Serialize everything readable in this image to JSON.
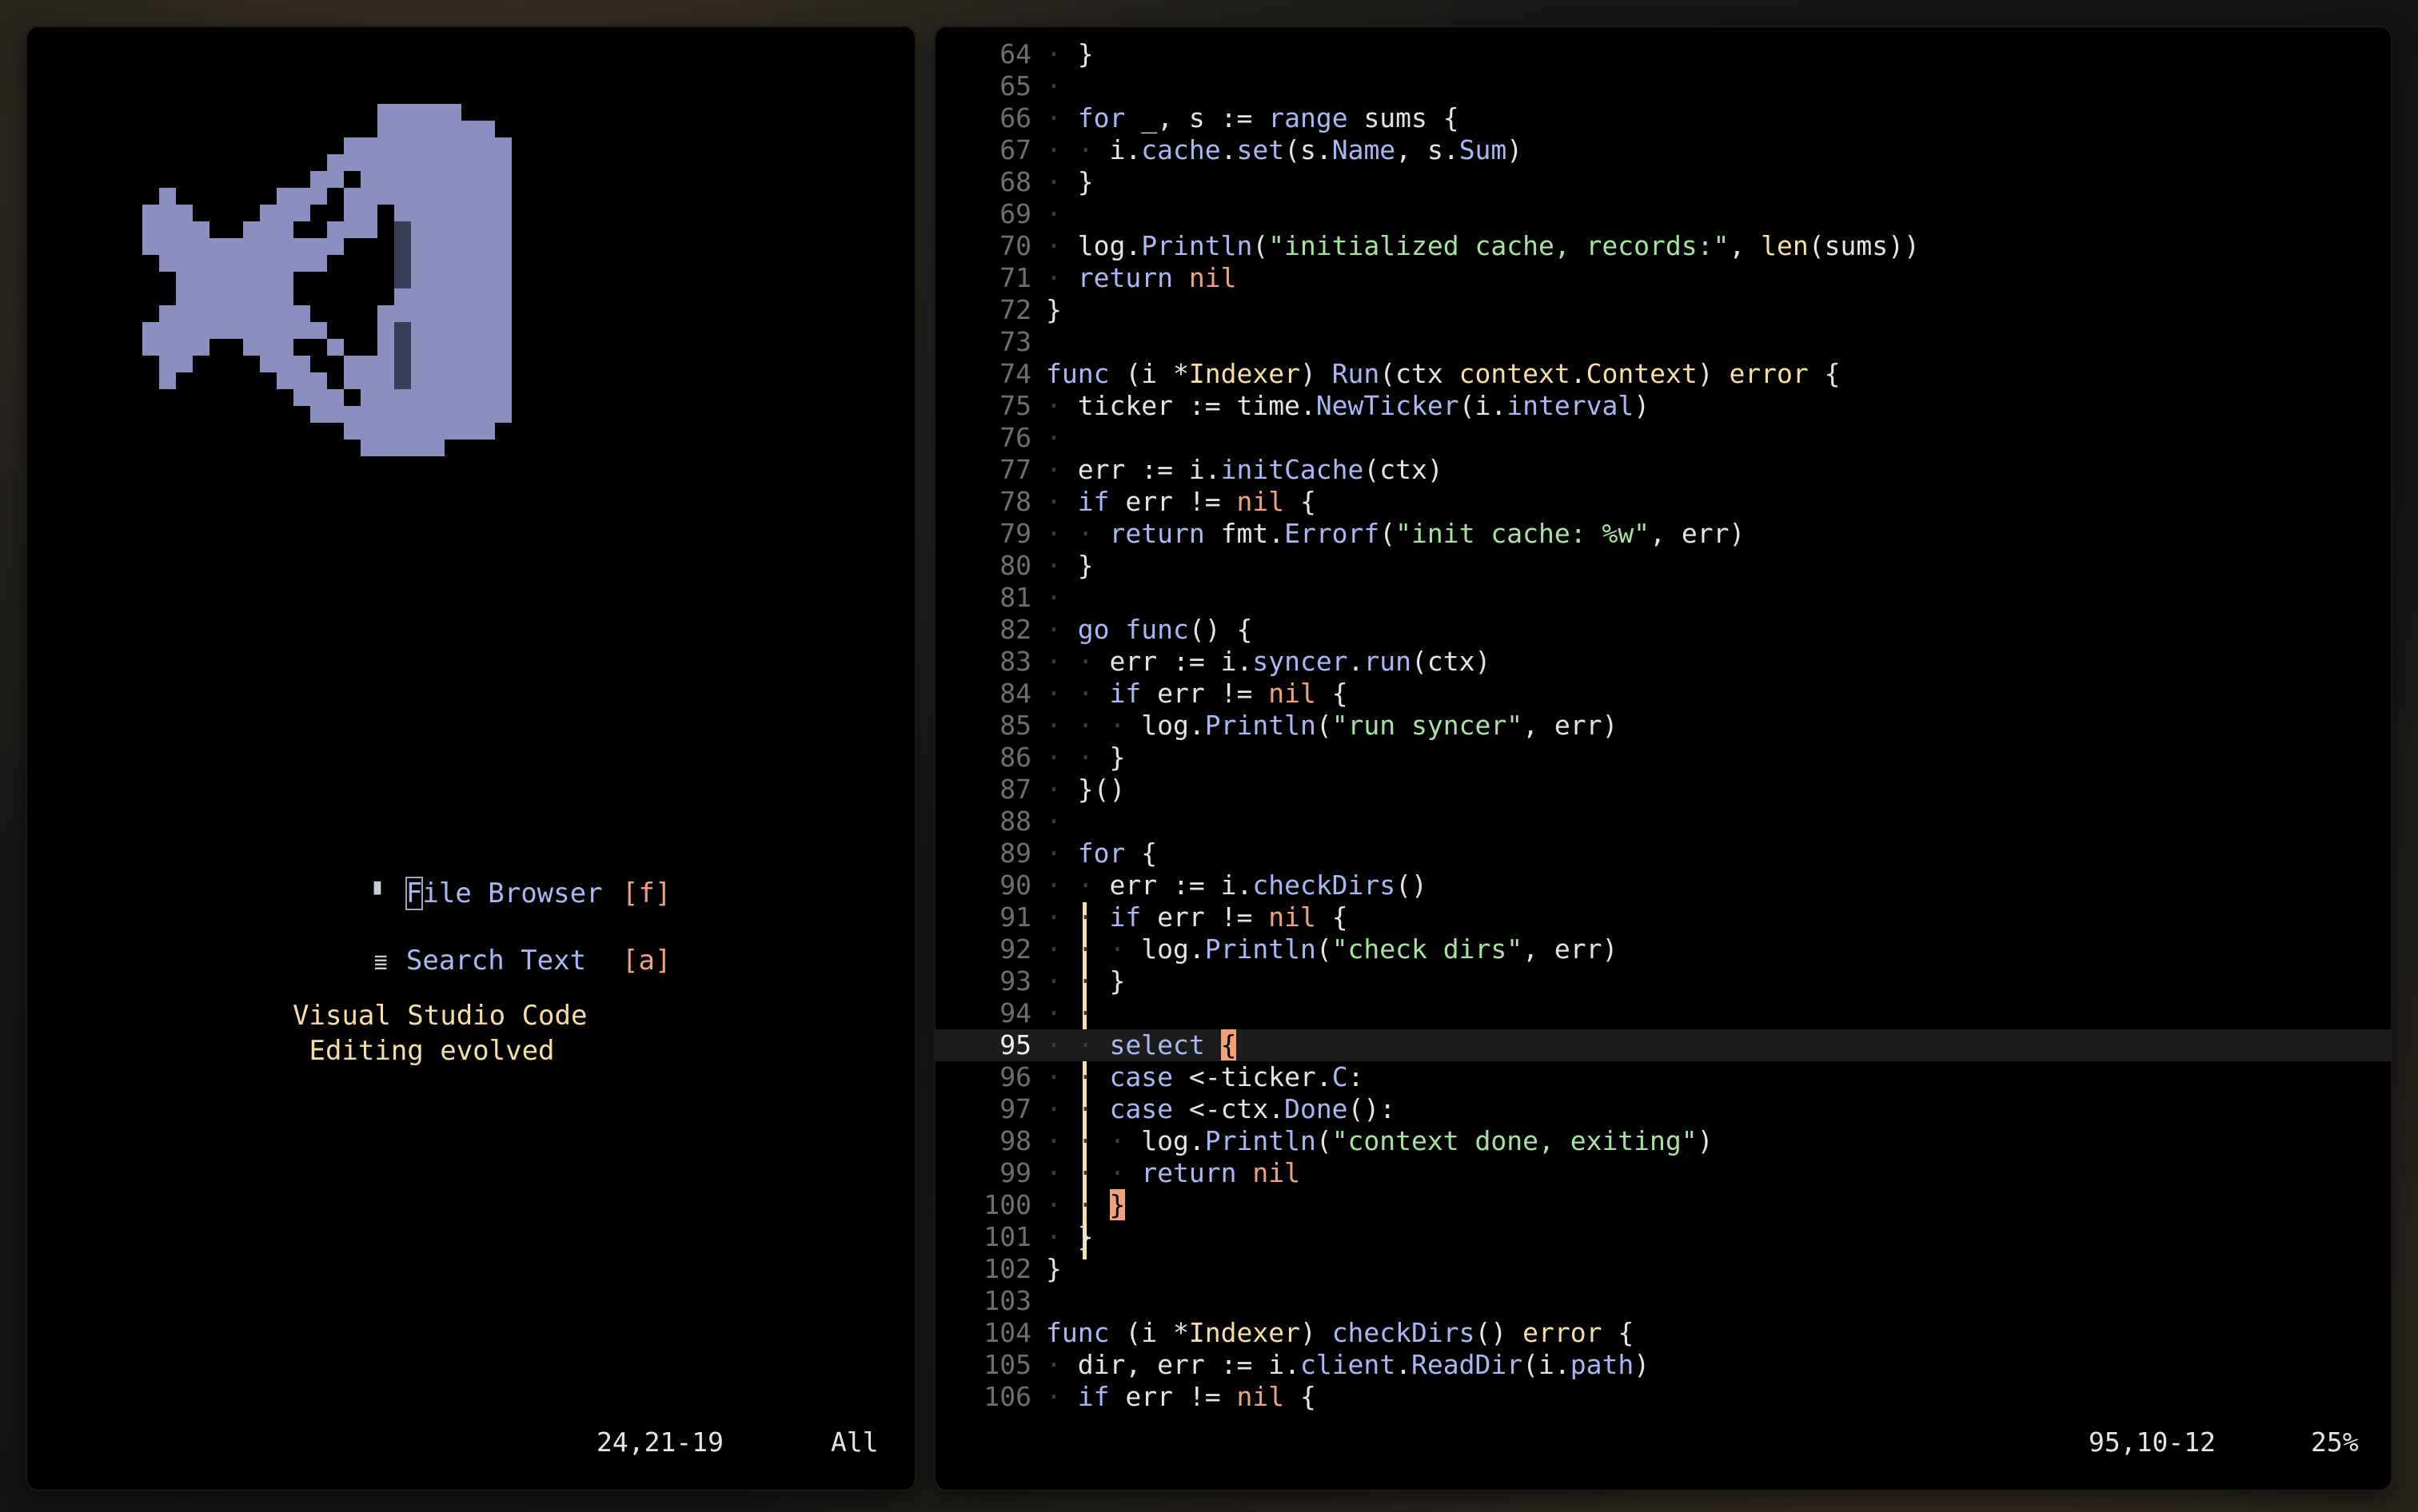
{
  "start_screen": {
    "menu": [
      {
        "icon": "file-icon",
        "label_first": "F",
        "label_rest": "ile Browser",
        "shortcut": "[f]"
      },
      {
        "icon": "text-lines-icon",
        "label": "Search Text",
        "shortcut": "[a]"
      }
    ],
    "tagline_1": "Visual Studio Code",
    "tagline_2": " Editing evolved",
    "status_pos": "24,21-19",
    "status_scroll": "All"
  },
  "editor": {
    "current_line": 95,
    "status_pos": "95,10-12",
    "status_scroll": "25%",
    "lines": [
      {
        "n": "64",
        "code": "· }"
      },
      {
        "n": "65",
        "code": "·"
      },
      {
        "n": "66",
        "code": "· for _, s := range sums {"
      },
      {
        "n": "67",
        "code": "· · i.cache.set(s.Name, s.Sum)"
      },
      {
        "n": "68",
        "code": "· }"
      },
      {
        "n": "69",
        "code": "·"
      },
      {
        "n": "70",
        "code": "· log.Println(\"initialized cache, records:\", len(sums))"
      },
      {
        "n": "71",
        "code": "· return nil"
      },
      {
        "n": "72",
        "code": "}"
      },
      {
        "n": "73",
        "code": ""
      },
      {
        "n": "74",
        "code": "func (i *Indexer) Run(ctx context.Context) error {"
      },
      {
        "n": "75",
        "code": "· ticker := time.NewTicker(i.interval)"
      },
      {
        "n": "76",
        "code": "·"
      },
      {
        "n": "77",
        "code": "· err := i.initCache(ctx)"
      },
      {
        "n": "78",
        "code": "· if err != nil {"
      },
      {
        "n": "79",
        "code": "· · return fmt.Errorf(\"init cache: %w\", err)"
      },
      {
        "n": "80",
        "code": "· }"
      },
      {
        "n": "81",
        "code": "·"
      },
      {
        "n": "82",
        "code": "· go func() {"
      },
      {
        "n": "83",
        "code": "· · err := i.syncer.run(ctx)"
      },
      {
        "n": "84",
        "code": "· · if err != nil {"
      },
      {
        "n": "85",
        "code": "· · · log.Println(\"run syncer\", err)"
      },
      {
        "n": "86",
        "code": "· · }"
      },
      {
        "n": "87",
        "code": "· }()"
      },
      {
        "n": "88",
        "code": "·"
      },
      {
        "n": "89",
        "code": "· for {"
      },
      {
        "n": "90",
        "code": "· · err := i.checkDirs()"
      },
      {
        "n": "91",
        "code": "· · if err != nil {"
      },
      {
        "n": "92",
        "code": "· · · log.Println(\"check dirs\", err)"
      },
      {
        "n": "93",
        "code": "· · }"
      },
      {
        "n": "94",
        "code": "· ·"
      },
      {
        "n": "95",
        "code": "· · select {"
      },
      {
        "n": "96",
        "code": "· · case <-ticker.C:"
      },
      {
        "n": "97",
        "code": "· · case <-ctx.Done():"
      },
      {
        "n": "98",
        "code": "· · · log.Println(\"context done, exiting\")"
      },
      {
        "n": "99",
        "code": "· · · return nil"
      },
      {
        "n": "100",
        "code": "· · }"
      },
      {
        "n": "101",
        "code": "· }"
      },
      {
        "n": "102",
        "code": "}"
      },
      {
        "n": "103",
        "code": ""
      },
      {
        "n": "104",
        "code": "func (i *Indexer) checkDirs() error {"
      },
      {
        "n": "105",
        "code": "· dir, err := i.client.ReadDir(i.path)"
      },
      {
        "n": "106",
        "code": "· if err != nil {"
      }
    ]
  },
  "colors": {
    "logo": "#8a8fc0",
    "logo_shadow": "#3a3d58",
    "keyword": "#a9b8f5",
    "type": "#f6dfa0",
    "string": "#a7e2a0",
    "nil": "#f1a27a"
  }
}
